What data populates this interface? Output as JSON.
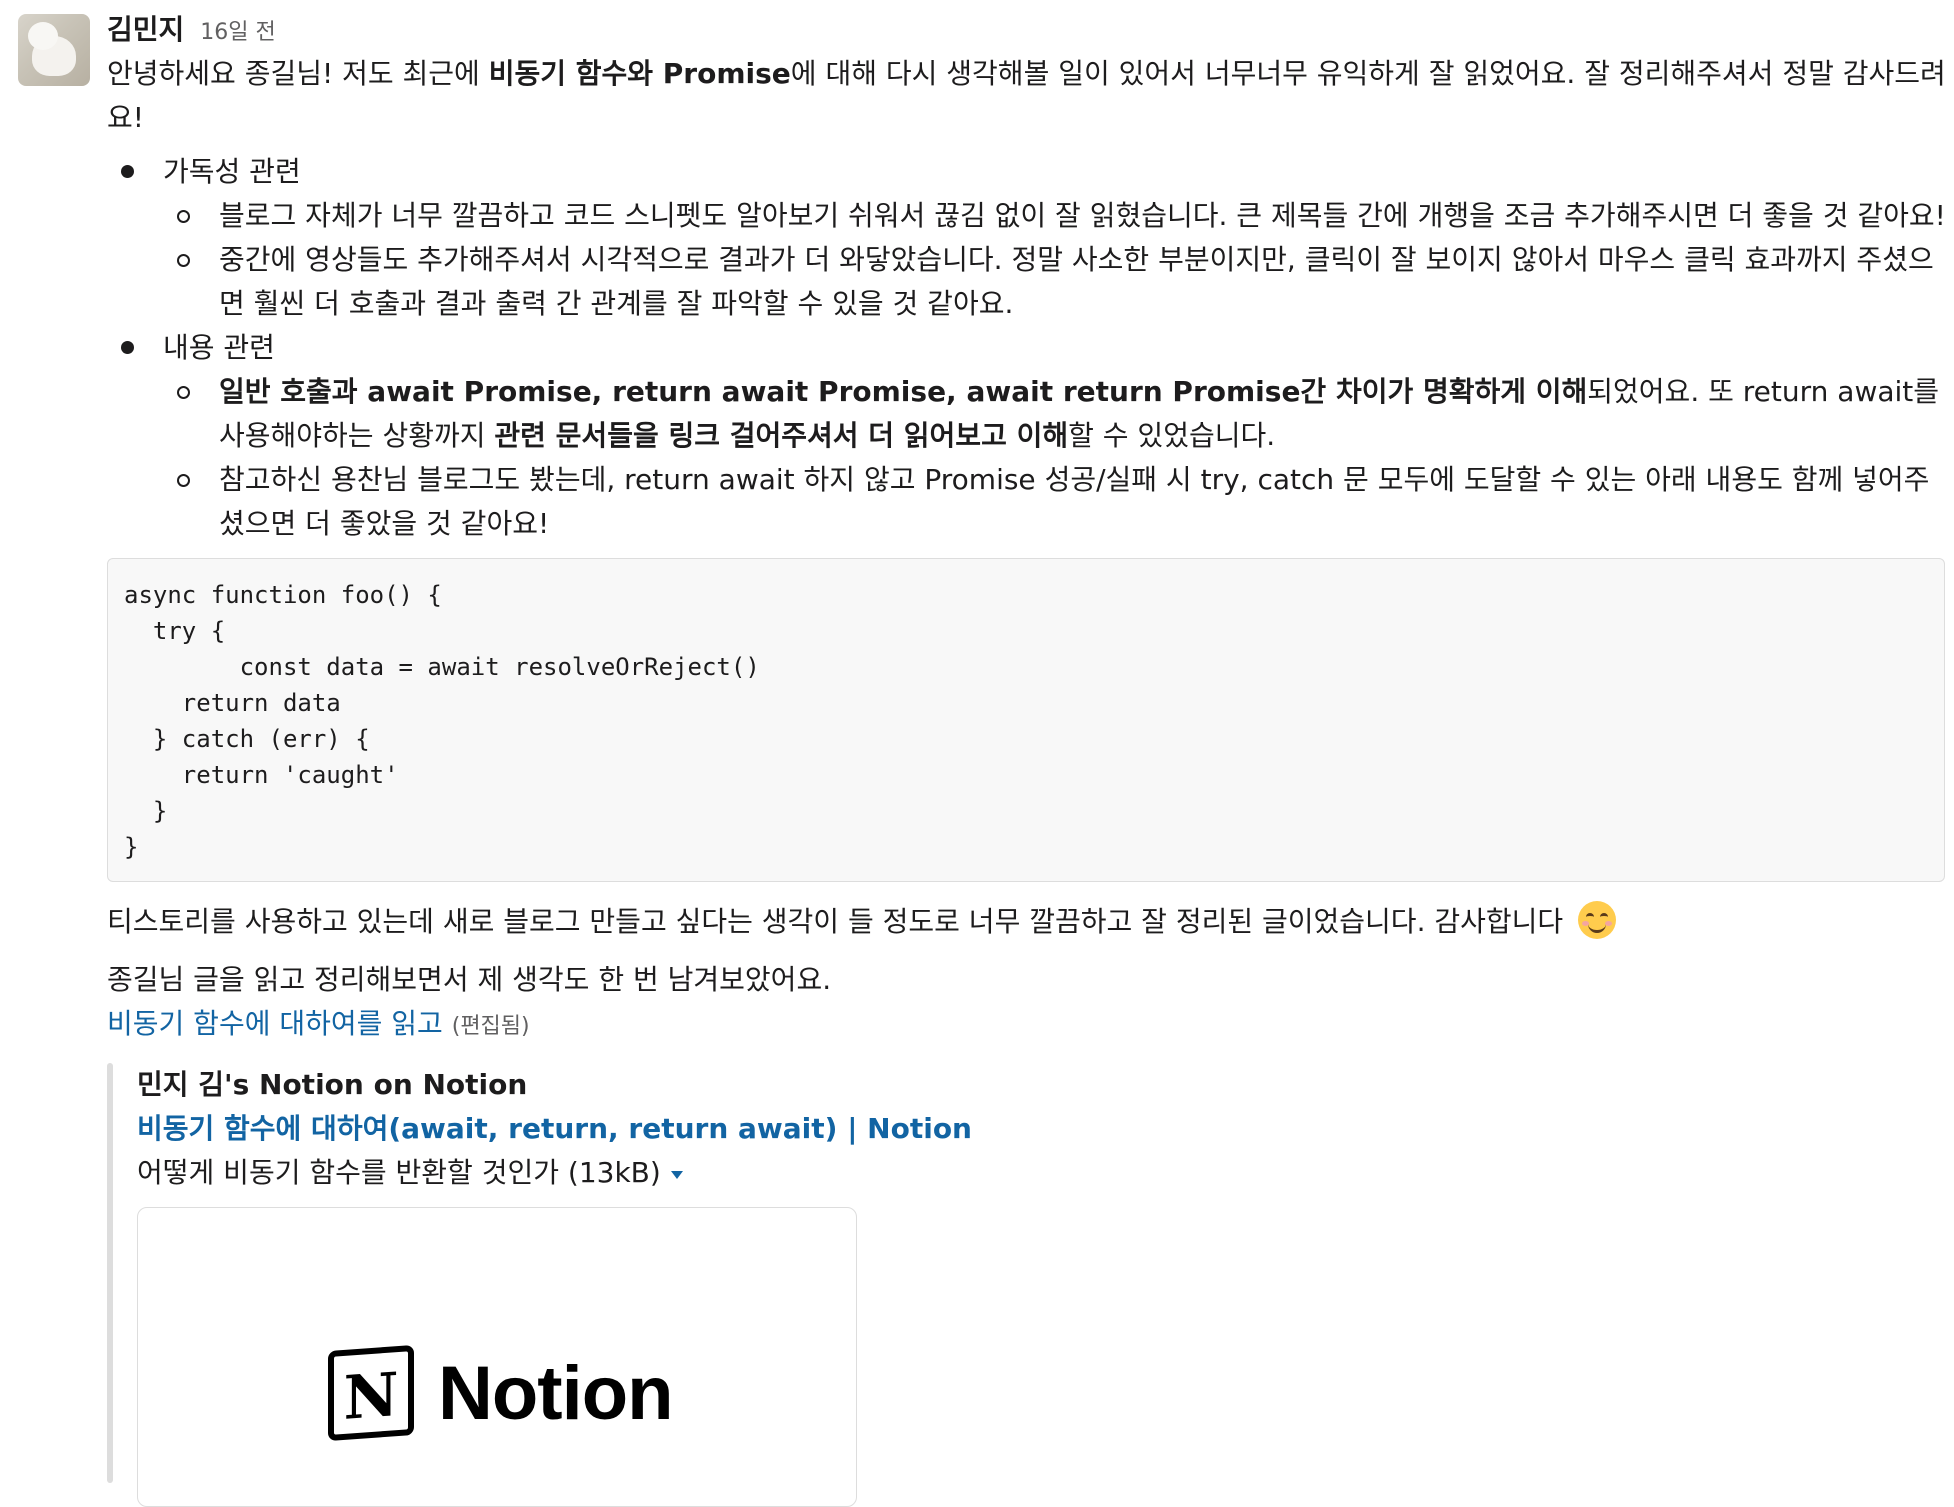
{
  "message": {
    "author": "김민지",
    "timestamp": "16일 전",
    "intro": {
      "t1": "안녕하세요 종길님! 저도 최근에 ",
      "b1": "비동기 함수와 Promise",
      "t2": "에 대해 다시 생각해볼 일이 있어서 너무너무 유익하게 잘 읽었어요. 잘 정리해주셔서 정말 감사드려요!"
    },
    "sections": [
      {
        "label": "가독성 관련",
        "items": [
          {
            "text": "블로그 자체가 너무 깔끔하고 코드 스니펫도 알아보기 쉬워서 끊김 없이 잘 읽혔습니다. 큰 제목들 간에 개행을 조금 추가해주시면 더 좋을 것 같아요!"
          },
          {
            "text": "중간에 영상들도 추가해주셔서 시각적으로 결과가 더 와닿았습니다. 정말 사소한 부분이지만, 클릭이 잘 보이지 않아서 마우스 클릭 효과까지 주셨으면 훨씬 더 호출과 결과 출력 간 관계를 잘 파악할 수 있을 것 같아요."
          }
        ]
      },
      {
        "label": "내용 관련",
        "items": [
          {
            "b1": "일반 호출과 await Promise, return await Promise, await return Promise간 차이가 명확하게 이해",
            "t1": "되었어요. 또 return await를 사용해야하는 상황까지 ",
            "b2": "관련 문서들을 링크 걸어주셔서 더 읽어보고 이해",
            "t2": "할 수 있었습니다."
          },
          {
            "text": "참고하신 용찬님 블로그도 봤는데, return await 하지 않고 Promise 성공/실패 시 try, catch 문 모두에 도달할 수 있는 아래 내용도 함께 넣어주셨으면 더 좋았을 것 같아요!"
          }
        ]
      }
    ],
    "code": "async function foo() {\n  try {\n        const data = await resolveOrReject()\n    return data\n  } catch (err) {\n    return 'caught'\n  }\n}",
    "closing": "티스토리를 사용하고 있는데 새로 블로그 만들고 싶다는 생각이 들 정도로 너무 깔끔하고 잘 정리된 글이었습니다. 감사합니다",
    "closing_emoji": "smiling-face-icon",
    "followup": "종길님 글을 읽고 정리해보면서 제 생각도 한 번 남겨보았어요.",
    "link_text": "비동기 함수에 대하여를 읽고",
    "edited_label": "(편집됨)",
    "attachment": {
      "site": "민지 김's Notion on Notion",
      "title": "비동기 함수에 대하여(await, return, return await) | Notion",
      "description": "어떻게 비동기 함수를 반환할 것인가 (13kB)",
      "logo_text": "Notion",
      "logo_mark": "N"
    },
    "colors": {
      "link": "#1264a3",
      "text": "#1d1c1d",
      "muted": "#616061",
      "code_bg": "#f8f8f8"
    }
  }
}
